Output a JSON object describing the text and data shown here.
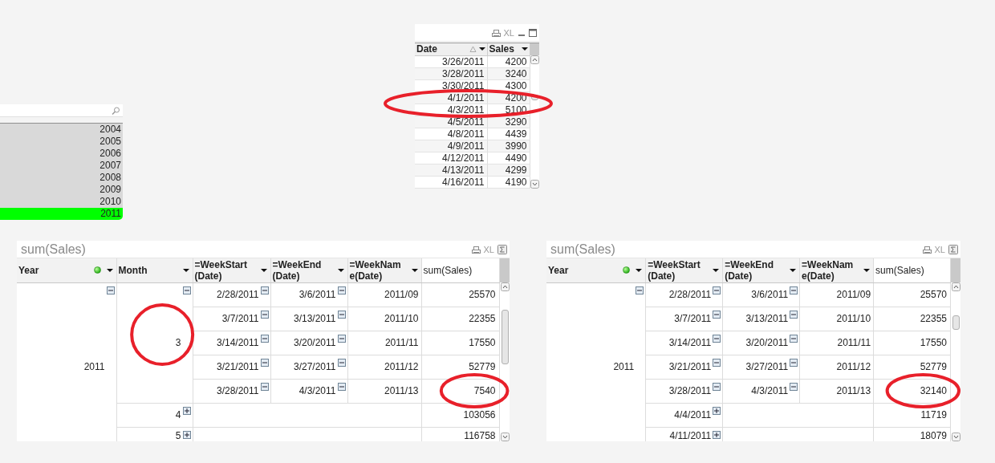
{
  "date_table": {
    "export_label": "XL",
    "columns": [
      {
        "label": "Date",
        "sort_indicator": true
      },
      {
        "label": "Sales",
        "sort_indicator": false
      }
    ],
    "rows": [
      {
        "cells": [
          "3/26/2011",
          "4200"
        ],
        "circled": false
      },
      {
        "cells": [
          "3/28/2011",
          "3240"
        ],
        "circled": false
      },
      {
        "cells": [
          "3/30/2011",
          "4300"
        ],
        "circled": false
      },
      {
        "cells": [
          "4/1/2011",
          "4200"
        ],
        "circled": true
      },
      {
        "cells": [
          "4/3/2011",
          "5100"
        ],
        "circled": true
      },
      {
        "cells": [
          "4/5/2011",
          "3290"
        ],
        "circled": false
      },
      {
        "cells": [
          "4/8/2011",
          "4439"
        ],
        "circled": false
      },
      {
        "cells": [
          "4/9/2011",
          "3990"
        ],
        "circled": false
      },
      {
        "cells": [
          "4/12/2011",
          "4490"
        ],
        "circled": false
      },
      {
        "cells": [
          "4/13/2011",
          "4299"
        ],
        "circled": false
      },
      {
        "cells": [
          "4/16/2011",
          "4190"
        ],
        "circled": false
      }
    ]
  },
  "list_box": {
    "items": [
      {
        "label": "2004",
        "selected": false
      },
      {
        "label": "2005",
        "selected": false
      },
      {
        "label": "2006",
        "selected": false
      },
      {
        "label": "2007",
        "selected": false
      },
      {
        "label": "2008",
        "selected": false
      },
      {
        "label": "2009",
        "selected": false
      },
      {
        "label": "2010",
        "selected": false
      },
      {
        "label": "2011",
        "selected": true
      }
    ]
  },
  "pivot_tables": [
    {
      "title": "sum(Sales)",
      "export_label": "XL",
      "columns": [
        {
          "label_lines": [
            "Year"
          ],
          "selection_dot": true
        },
        {
          "label_lines": [
            "Month"
          ],
          "selection_dot": false
        },
        {
          "label_lines": [
            "=WeekStart",
            "(Date)"
          ],
          "selection_dot": false
        },
        {
          "label_lines": [
            "=WeekEnd",
            "(Date)"
          ],
          "selection_dot": false
        },
        {
          "label_lines": [
            "=WeekNam",
            "e(Date)"
          ],
          "selection_dot": false
        },
        {
          "label_lines": [
            "sum(Sales)"
          ]
        }
      ],
      "rows": [
        {
          "value": "2011",
          "expanded": true,
          "children": [
            {
              "value": "3",
              "expanded": true,
              "circled": true,
              "children": [
                {
                  "value": "2/28/2011",
                  "expanded": true,
                  "children": [
                    {
                      "value": "3/6/2011",
                      "expanded": true,
                      "children": [
                        {
                          "value": "2011/09",
                          "total": "25570",
                          "total_circled": false
                        }
                      ]
                    }
                  ]
                },
                {
                  "value": "3/7/2011",
                  "expanded": true,
                  "children": [
                    {
                      "value": "3/13/2011",
                      "expanded": true,
                      "children": [
                        {
                          "value": "2011/10",
                          "total": "22355",
                          "total_circled": false
                        }
                      ]
                    }
                  ]
                },
                {
                  "value": "3/14/2011",
                  "expanded": true,
                  "children": [
                    {
                      "value": "3/20/2011",
                      "expanded": true,
                      "children": [
                        {
                          "value": "2011/11",
                          "total": "17550",
                          "total_circled": false
                        }
                      ]
                    }
                  ]
                },
                {
                  "value": "3/21/2011",
                  "expanded": true,
                  "children": [
                    {
                      "value": "3/27/2011",
                      "expanded": true,
                      "children": [
                        {
                          "value": "2011/12",
                          "total": "52779",
                          "total_circled": false
                        }
                      ]
                    }
                  ]
                },
                {
                  "value": "3/28/2011",
                  "expanded": true,
                  "children": [
                    {
                      "value": "4/3/2011",
                      "expanded": true,
                      "children": [
                        {
                          "value": "2011/13",
                          "total": "7540",
                          "total_circled": true
                        }
                      ]
                    }
                  ]
                }
              ]
            },
            {
              "value": "4",
              "expanded": false,
              "circled": false,
              "total": "103056",
              "total_circled": false
            },
            {
              "value": "5",
              "expanded": false,
              "circled": false,
              "total": "116758",
              "total_circled": false
            }
          ]
        }
      ]
    },
    {
      "title": "sum(Sales)",
      "export_label": "XL",
      "columns": [
        {
          "label_lines": [
            "Year"
          ],
          "selection_dot": true
        },
        {
          "label_lines": [
            "=WeekStart",
            "(Date)"
          ],
          "selection_dot": false
        },
        {
          "label_lines": [
            "=WeekEnd",
            "(Date)"
          ],
          "selection_dot": false
        },
        {
          "label_lines": [
            "=WeekNam",
            "e(Date)"
          ],
          "selection_dot": false
        },
        {
          "label_lines": [
            "sum(Sales)"
          ]
        }
      ],
      "rows": [
        {
          "value": "2011",
          "expanded": true,
          "children": [
            {
              "value": "2/28/2011",
              "expanded": true,
              "children": [
                {
                  "value": "3/6/2011",
                  "expanded": true,
                  "children": [
                    {
                      "value": "2011/09",
                      "total": "25570",
                      "total_circled": false
                    }
                  ]
                }
              ]
            },
            {
              "value": "3/7/2011",
              "expanded": true,
              "children": [
                {
                  "value": "3/13/2011",
                  "expanded": true,
                  "children": [
                    {
                      "value": "2011/10",
                      "total": "22355",
                      "total_circled": false
                    }
                  ]
                }
              ]
            },
            {
              "value": "3/14/2011",
              "expanded": true,
              "children": [
                {
                  "value": "3/20/2011",
                  "expanded": true,
                  "children": [
                    {
                      "value": "2011/11",
                      "total": "17550",
                      "total_circled": false
                    }
                  ]
                }
              ]
            },
            {
              "value": "3/21/2011",
              "expanded": true,
              "children": [
                {
                  "value": "3/27/2011",
                  "expanded": true,
                  "children": [
                    {
                      "value": "2011/12",
                      "total": "52779",
                      "total_circled": false
                    }
                  ]
                }
              ]
            },
            {
              "value": "3/28/2011",
              "expanded": true,
              "children": [
                {
                  "value": "4/3/2011",
                  "expanded": true,
                  "children": [
                    {
                      "value": "2011/13",
                      "total": "32140",
                      "total_circled": true
                    }
                  ]
                }
              ]
            },
            {
              "value": "4/4/2011",
              "expanded": false,
              "total": "11719",
              "total_circled": false
            },
            {
              "value": "4/11/2011",
              "expanded": false,
              "total": "18079",
              "total_circled": false
            }
          ]
        }
      ]
    }
  ]
}
